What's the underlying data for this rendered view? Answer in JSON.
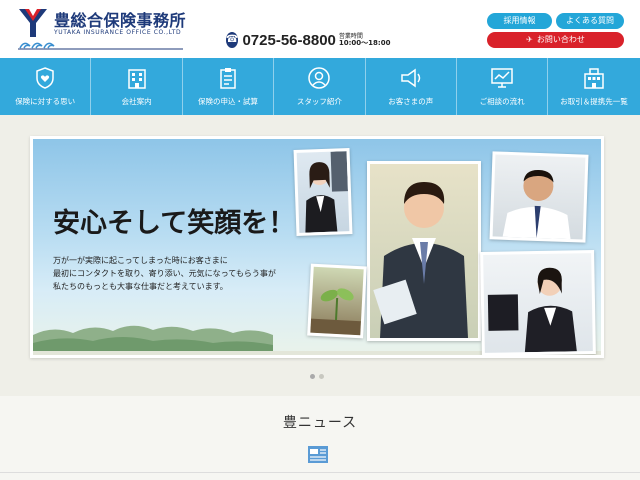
{
  "header": {
    "company_name": "豊総合保険事務所",
    "company_name_en": "YUTAKA INSURANCE OFFICE CO.,LTD",
    "phone": "0725-56-8800",
    "hours_label": "営業時間",
    "hours_time": "10:00〜18:00",
    "recruit_label": "採用情報",
    "faq_label": "よくある質問",
    "contact_label": "お問い合わせ"
  },
  "nav": {
    "items": [
      {
        "label": "保険に対する思い",
        "icon": "shield-heart-icon"
      },
      {
        "label": "会社案内",
        "icon": "building-icon"
      },
      {
        "label": "保険の申込・試算",
        "icon": "clipboard-icon"
      },
      {
        "label": "スタッフ紹介",
        "icon": "staff-icon"
      },
      {
        "label": "お客さまの声",
        "icon": "megaphone-icon"
      },
      {
        "label": "ご相談の流れ",
        "icon": "monitor-chart-icon"
      },
      {
        "label": "お取引＆提携先一覧",
        "icon": "office-icon"
      }
    ]
  },
  "hero": {
    "headline": "安心そして笑顔を！",
    "copy_line1": "万が一が実際に起こってしまった時にお客さまに",
    "copy_line2": "最初にコンタクトを取り、寄り添い、元気になってもらう事が",
    "copy_line3": "私たちのもっとも大事な仕事だと考えています。"
  },
  "news": {
    "title": "豊ニュース",
    "icon": "news-icon"
  },
  "colors": {
    "primary": "#33a9dc",
    "navy": "#1e3a7a",
    "contact_red": "#d9222a",
    "background": "#efefe8"
  }
}
